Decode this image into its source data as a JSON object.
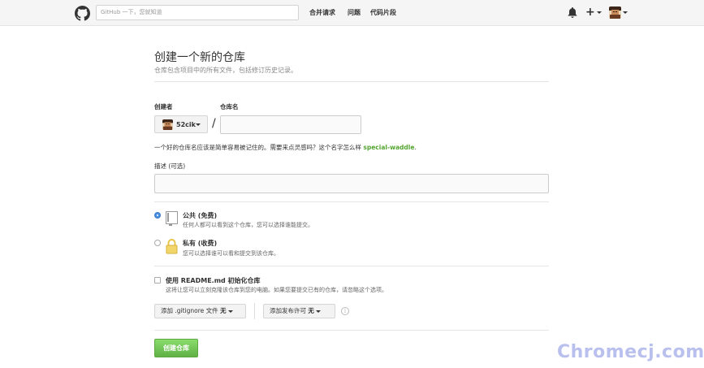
{
  "header": {
    "search_placeholder": "GitHub 一下，您就知道",
    "nav": {
      "pull_requests": "合并请求",
      "issues": "问题",
      "snippets": "代码片段"
    }
  },
  "page": {
    "title": "创建一个新的仓库",
    "subtitle": "仓库包含项目中的所有文件，包括修订历史记录。"
  },
  "form": {
    "owner_label": "创建者",
    "owner_value": "52cik",
    "slash": "/",
    "repo_name_label": "仓库名",
    "repo_name_value": "",
    "hint_text": "一个好的仓库名应该是简单容易被记住的。需要来点灵感吗？这个名字怎么样",
    "hint_suggestion": "special-waddle",
    "hint_period": ".",
    "description_label": "描述 (可选)",
    "description_value": "",
    "visibility": {
      "selected": "public",
      "public_title": "公共 (免费)",
      "public_desc": "任何人都可以看到这个仓库，您可以选择谁能提交。",
      "private_title": "私有 (收费)",
      "private_desc": "您可以选择谁可以看和提交到该仓库。"
    },
    "init_readme_label": "使用 README.md 初始化仓库",
    "init_readme_checked": false,
    "init_readme_desc": "这将让您可以立刻克隆该仓库到您的电脑。如果您要提交已有的仓库，请忽略这个选项。",
    "gitignore_label": "添加 .gitignore 文件",
    "gitignore_value": "无",
    "license_label": "添加发布许可",
    "license_value": "无",
    "info_icon_glyph": "i",
    "submit_label": "创建仓库"
  },
  "watermark": "Chromecj.com",
  "colors": {
    "primary_button": "#60b044",
    "suggestion": "#55a532",
    "radio_selected": "#4a90e2"
  }
}
